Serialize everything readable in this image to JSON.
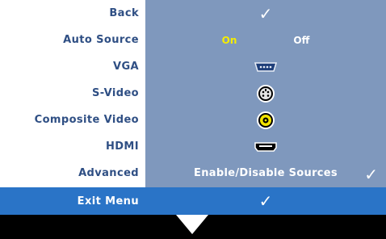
{
  "menu": {
    "items": [
      {
        "label": "Back",
        "value_type": "check"
      },
      {
        "label": "Auto Source",
        "on_label": "On",
        "off_label": "Off",
        "selected": "On"
      },
      {
        "label": "VGA",
        "icon": "vga-port-icon"
      },
      {
        "label": "S-Video",
        "icon": "svideo-port-icon"
      },
      {
        "label": "Composite Video",
        "icon": "composite-port-icon"
      },
      {
        "label": "HDMI",
        "icon": "hdmi-port-icon"
      },
      {
        "label": "Advanced",
        "value_text": "Enable/Disable Sources"
      }
    ],
    "exit_label": "Exit Menu"
  },
  "colors": {
    "label_text": "#2f4f84",
    "value_panel": "#7f98bd",
    "selected_on": "#f5ed00",
    "exit_bar": "#2a74c7"
  },
  "icons": {
    "checkmark": "checkmark-icon",
    "down_arrow": "down-arrow-icon"
  }
}
